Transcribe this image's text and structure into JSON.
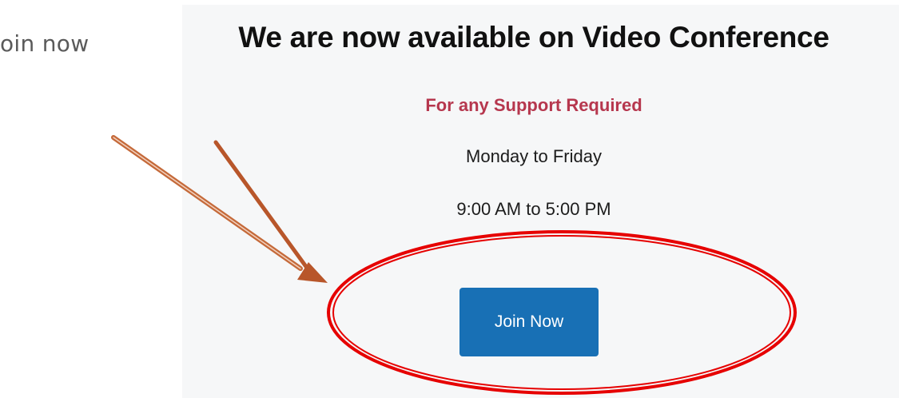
{
  "side_caption": "oin now",
  "panel": {
    "headline": "We are now available on Video Conference",
    "support_label": "For any Support Required",
    "days": "Monday to Friday",
    "hours": "9:00 AM to 5:00 PM",
    "join_button_label": "Join Now"
  },
  "colors": {
    "support_text": "#b6374e",
    "button": "#1870b5",
    "annotation_ellipse": "#e60000",
    "annotation_arrow": "#b8562a"
  }
}
